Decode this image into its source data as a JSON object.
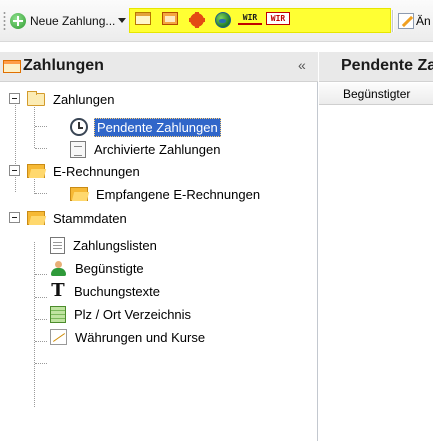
{
  "toolbar": {
    "new_payment_label": "Neue Zahlung...",
    "edit_label": "Än",
    "wir_label_1": "WIR",
    "wir_label_2": "WIR",
    "highlight_color": "#ffff33"
  },
  "left_panel": {
    "title": "Zahlungen",
    "collapse_glyph": "«",
    "tree": [
      {
        "label": "Zahlungen",
        "icon": "folder-closed-icon"
      },
      {
        "label": "Pendente Zahlungen",
        "icon": "clock-icon",
        "selected": true
      },
      {
        "label": "Archivierte Zahlungen",
        "icon": "archive-icon"
      },
      {
        "label": "E-Rechnungen",
        "icon": "folder-open-icon"
      },
      {
        "label": "Empfangene E-Rechnungen",
        "icon": "folder-open-icon"
      },
      {
        "label": "Stammdaten",
        "icon": "folder-open-icon"
      },
      {
        "label": "Zahlungslisten",
        "icon": "document-icon"
      },
      {
        "label": "Begünstigte",
        "icon": "person-icon"
      },
      {
        "label": "Buchungstexte",
        "icon": "text-icon"
      },
      {
        "label": "Plz / Ort Verzeichnis",
        "icon": "table-icon"
      },
      {
        "label": "Währungen und Kurse",
        "icon": "chart-icon"
      }
    ]
  },
  "right_panel": {
    "title": "Pendente Zahlungen",
    "column_header": "Begünstigter"
  },
  "colors": {
    "selection": "#3066c9",
    "header_bg": "#e9e9e9"
  }
}
